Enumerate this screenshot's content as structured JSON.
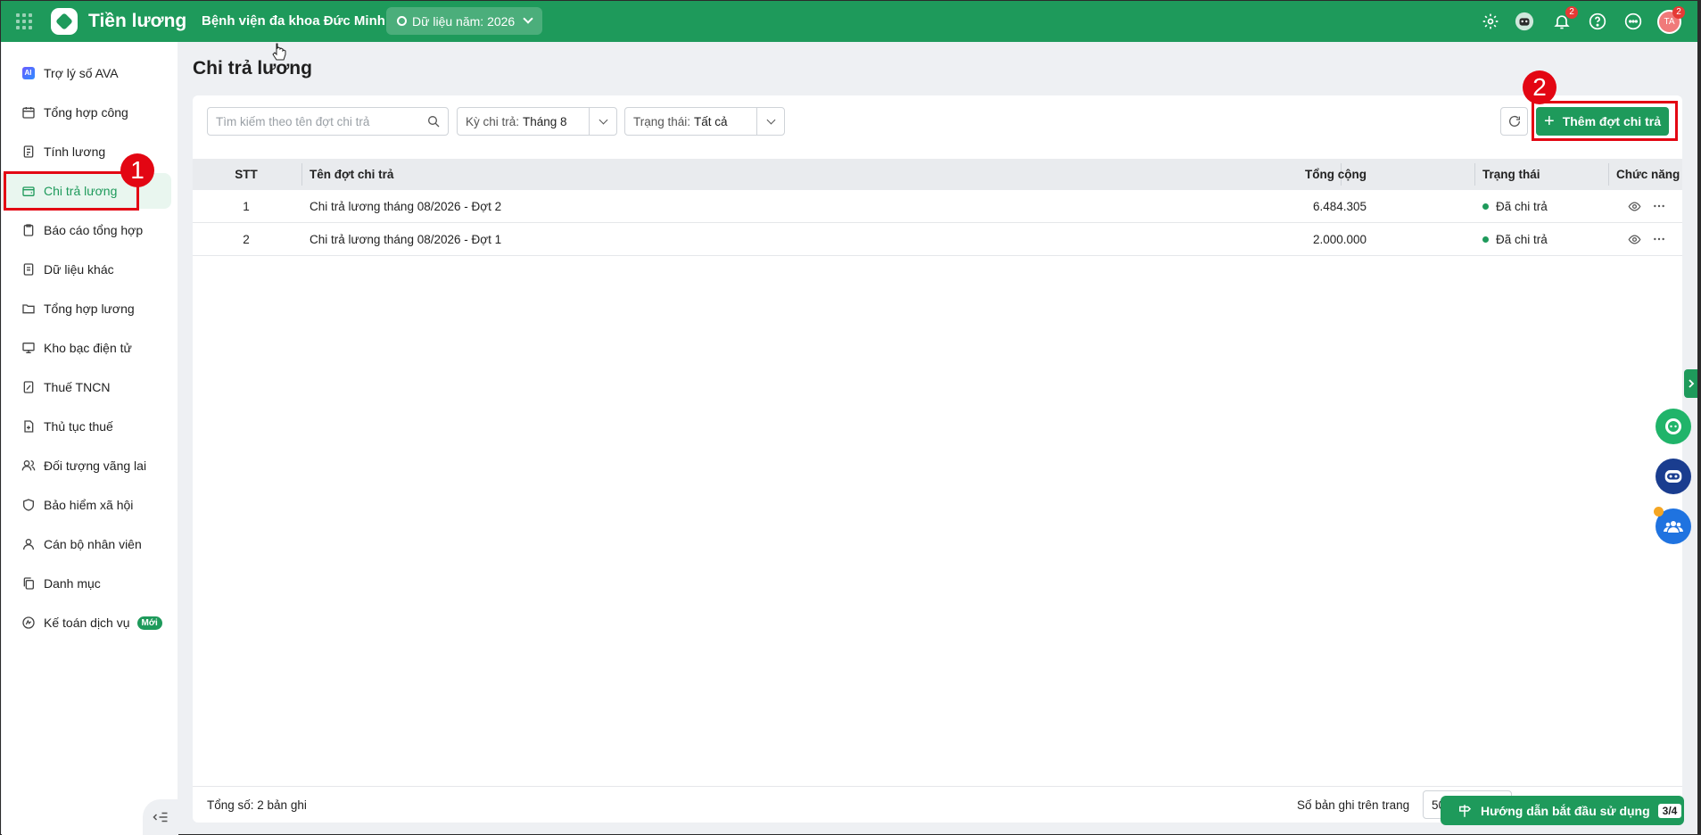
{
  "header": {
    "app_name": "Tiền lương",
    "org_name": "Bệnh viện đa khoa Đức Minh",
    "year_selector": "Dữ liệu năm: 2026",
    "notification_count": "2",
    "avatar_initials": "TA",
    "avatar_badge": "2"
  },
  "sidebar": {
    "items": [
      {
        "label": "Trợ lý số AVA",
        "icon": "ai-icon"
      },
      {
        "label": "Tổng hợp công",
        "icon": "calendar-icon"
      },
      {
        "label": "Tính lương",
        "icon": "calculator-icon"
      },
      {
        "label": "Chi trả lương",
        "icon": "wallet-icon"
      },
      {
        "label": "Báo cáo tổng hợp",
        "icon": "clipboard-icon"
      },
      {
        "label": "Dữ liệu khác",
        "icon": "document-icon"
      },
      {
        "label": "Tổng hợp lương",
        "icon": "folder-icon"
      },
      {
        "label": "Kho bạc điện tử",
        "icon": "monitor-icon"
      },
      {
        "label": "Thuế TNCN",
        "icon": "tax-icon"
      },
      {
        "label": "Thủ tục thuế",
        "icon": "file-plus-icon"
      },
      {
        "label": "Đối tượng vãng lai",
        "icon": "users-icon"
      },
      {
        "label": "Bảo hiểm xã hội",
        "icon": "shield-heart-icon"
      },
      {
        "label": "Cán bộ nhân viên",
        "icon": "user-icon"
      },
      {
        "label": "Danh mục",
        "icon": "copy-icon"
      },
      {
        "label": "Kế toán dịch vụ",
        "icon": "service-icon",
        "tag": "Mới"
      }
    ]
  },
  "annotations": {
    "first": "1",
    "second": "2"
  },
  "page": {
    "title": "Chi trả lương",
    "search_placeholder": "Tìm kiếm theo tên đợt chi trả",
    "period_label": "Kỳ chi trả:",
    "period_value": "Tháng 8",
    "status_label": "Trạng thái:",
    "status_value": "Tất cả",
    "add_button": "Thêm đợt chi trả"
  },
  "table": {
    "columns": {
      "stt": "STT",
      "name": "Tên đợt chi trả",
      "total": "Tổng cộng",
      "status": "Trạng thái",
      "actions": "Chức năng"
    },
    "rows": [
      {
        "stt": "1",
        "name": "Chi trả lương tháng 08/2026 - Đợt 2",
        "total": "6.484.305",
        "status": "Đã chi trả"
      },
      {
        "stt": "2",
        "name": "Chi trả lương tháng 08/2026 - Đợt 1",
        "total": "2.000.000",
        "status": "Đã chi trả"
      }
    ]
  },
  "footer": {
    "total_text": "Tổng số: 2 bản ghi",
    "per_page_label": "Số bản ghi trên trang",
    "per_page_value": "50",
    "guide_button": "Hướng dẫn bắt đầu sử dụng",
    "guide_step": "3/4"
  },
  "colors": {
    "brand": "#1e9a5b",
    "annotation": "#e30613"
  }
}
